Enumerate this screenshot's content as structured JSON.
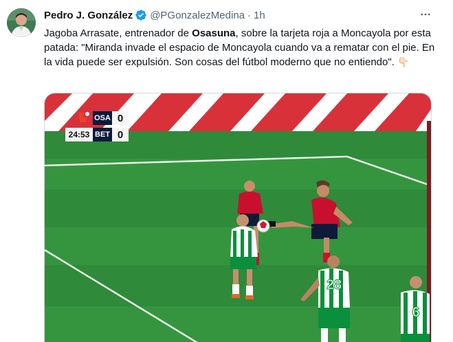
{
  "tweet": {
    "author_name": "Pedro J. González",
    "handle": "@PGonzalezMedina",
    "separator": "·",
    "time": "1h",
    "text_before": "Jagoba Arrasate, entrenador de ",
    "text_bold": "Osasuna",
    "text_after": ", sobre la tarjeta roja a Moncayola por esta patada: \"Miranda invade el espacio de Moncayola cuando va a rematar con el pie. En la vida puede ser expulsión. Son cosas del fútbol moderno que no entiendo\". ",
    "emoji": "👇🏻"
  },
  "scoreboard": {
    "clock": "24:53",
    "team_home": "OSA",
    "score_home": "0",
    "team_away": "BET",
    "score_away": "0"
  },
  "icons": {
    "verified": "verified-badge-icon",
    "more": "more-options-icon",
    "league": "laliga-logo-icon"
  },
  "colors": {
    "verified_blue": "#1d9bf0",
    "secondary_text": "#536471",
    "pitch_green": "#2f8f3f",
    "osasuna_red": "#c8102e",
    "betis_green": "#0a8f3c"
  }
}
